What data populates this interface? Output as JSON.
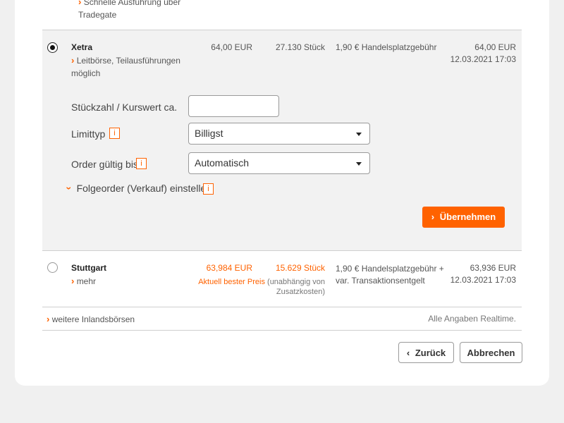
{
  "top_row": {
    "text_line1": "Schnelle Ausführung über",
    "text_line2": "Tradegate"
  },
  "xetra": {
    "name": "Xetra",
    "desc_line1": "Leitbörse, Teilausführungen",
    "desc_line2": "möglich",
    "price": "64,00 EUR",
    "qty": "27.130 Stück",
    "fee": "1,90 € Handelsplatzgebühr",
    "last_price": "64,00 EUR",
    "timestamp": "12.03.2021 17:03"
  },
  "form": {
    "qty_label": "Stückzahl / Kurswert ca.",
    "qty_value": "",
    "limit_label": "Limittyp",
    "limit_value": "Billigst",
    "valid_label": "Order gültig bis",
    "valid_value": "Automatisch",
    "followup_label": "Folgeorder (Verkauf) einstellen",
    "info_glyph": "i",
    "apply_label": "Übernehmen"
  },
  "stuttgart": {
    "name": "Stuttgart",
    "more": "mehr",
    "price": "63,984 EUR",
    "qty": "15.629 Stück",
    "best_price": "Aktuell bester Preis",
    "best_note_1": "(unabhängig von",
    "best_note_2": "Zusatzkosten)",
    "fee_line1": "1,90 € Handelsplatzgebühr +",
    "fee_line2": "var. Transaktionsentgelt",
    "last_price": "63,936 EUR",
    "timestamp": "12.03.2021 17:03"
  },
  "footer": {
    "more_exchanges": "weitere Inlandsbörsen",
    "realtime": "Alle Angaben Realtime.",
    "back": "Zurück",
    "cancel": "Abbrechen"
  },
  "colors": {
    "accent": "#ff6200"
  }
}
